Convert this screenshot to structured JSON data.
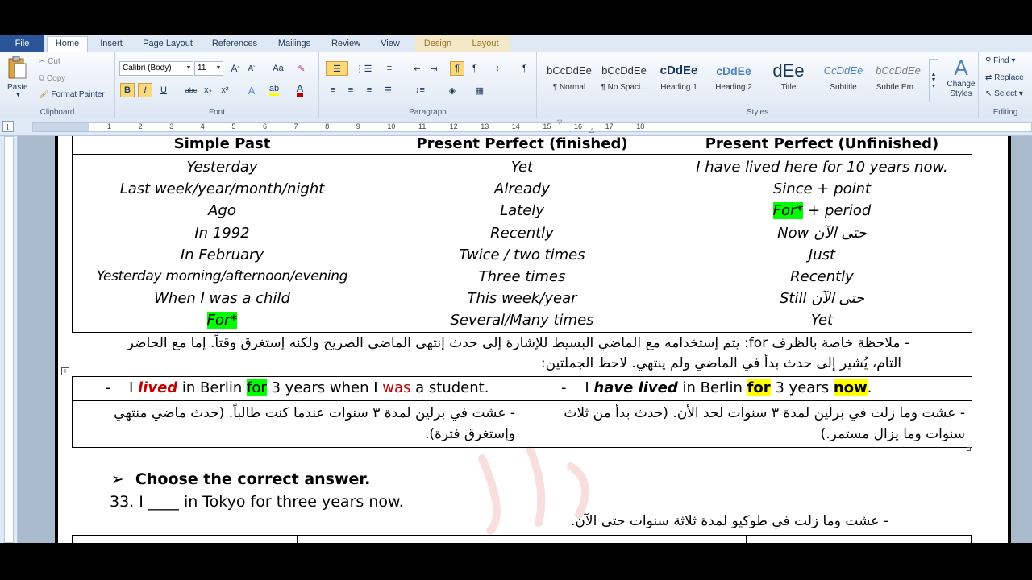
{
  "tabs": {
    "file": "File",
    "home": "Home",
    "insert": "Insert",
    "page_layout": "Page Layout",
    "references": "References",
    "mailings": "Mailings",
    "review": "Review",
    "view": "View",
    "design": "Design",
    "layout": "Layout"
  },
  "ribbon": {
    "clipboard": {
      "label": "Clipboard",
      "paste": "Paste",
      "cut": "Cut",
      "copy": "Copy",
      "format_painter": "Format Painter"
    },
    "font": {
      "label": "Font",
      "font_name": "Calibri (Body)",
      "font_size": "11",
      "grow": "A",
      "shrink": "A",
      "change_case": "Aa",
      "bold": "B",
      "italic": "I",
      "underline": "U",
      "strike": "abc",
      "subscript": "x₂",
      "superscript": "x²",
      "font_color": "A"
    },
    "paragraph": {
      "label": "Paragraph"
    },
    "styles": {
      "label": "Styles",
      "items": [
        {
          "sample": "bCcDdEe",
          "name": "¶ Normal"
        },
        {
          "sample": "bCcDdEe",
          "name": "¶ No Spaci..."
        },
        {
          "sample": "cDdEe",
          "name": "Heading 1"
        },
        {
          "sample": "cDdEe",
          "name": "Heading 2"
        },
        {
          "sample": "dEe",
          "name": "Title"
        },
        {
          "sample": "CcDdEe",
          "name": "Subtitle"
        },
        {
          "sample": "bCcDdEe",
          "name": "Subtle Em..."
        }
      ],
      "change_styles": "Change Styles"
    },
    "editing": {
      "label": "Editing",
      "find": "Find",
      "replace": "Replace",
      "select": "Select"
    }
  },
  "ruler": {
    "numbers": [
      "1",
      "2",
      "3",
      "4",
      "5",
      "6",
      "7",
      "8",
      "9",
      "10",
      "11",
      "12",
      "13",
      "14",
      "15",
      "16",
      "17",
      "18"
    ]
  },
  "document": {
    "table1": {
      "headers": [
        "Simple Past",
        "Present Perfect (finished)",
        "Present Perfect (Unfinished)"
      ],
      "col1": [
        "Yesterday",
        "Last week/year/month/night",
        "Ago",
        "In 1992",
        "In February",
        "Yesterday morning/afternoon/evening",
        "When I was a child",
        "For*"
      ],
      "col2": [
        "Yet",
        "Already",
        "Lately",
        "Recently",
        "Twice / two times",
        "Three times",
        "This week/year",
        "Several/Many times"
      ],
      "col3": {
        "r1": "I have lived here for 10 years now.",
        "r2": "Since + point",
        "r3_a": "For*",
        "r3_b": " + period",
        "r4": "Now حتى الآن",
        "r5": "Just",
        "r6": "Recently",
        "r7": "Still حتى الآن",
        "r8": "Yet"
      }
    },
    "note_line1": "-    ملاحظة خاصة بالظرف for: يتم إستخدامه مع الماضي البسيط للإشارة إلى حدث إنتهى الماضي الصريح ولكنه إستغرق وقتاً. إما مع الحاضر",
    "note_line2": "التام، يُشير إلى حدث بدأ في الماضي ولم ينتهي. لاحظ الجملتين:",
    "table2": {
      "left_en": {
        "dash": "-",
        "a": "I ",
        "b": "lived",
        "c": " in Berlin ",
        "d": "for",
        "e": " 3 years when I ",
        "f": "was",
        "g": " a student."
      },
      "right_en": {
        "dash": "-",
        "a": "I ",
        "b": "have lived",
        "c": " in Berlin ",
        "d": "for",
        "e": " 3 years ",
        "f": "now",
        "g": "."
      },
      "left_ar": "-     عشت في برلين لمدة ٣ سنوات عندما كنت طالباً. (حدث ماضي منتهي وإستغرق فترة).",
      "right_ar": "-     عشت وما زلت في برلين لمدة ٣ سنوات لحد الأن. (حدث بدأ من ثلاث سنوات وما يزال مستمر.)"
    },
    "choose": "Choose the correct answer.",
    "q33": "33.  I ____ in Tokyo for three years now.",
    "q33_ar": "-    عشت وما زلت في طوكيو لمدة ثلاثة سنوات حتى الآن."
  }
}
